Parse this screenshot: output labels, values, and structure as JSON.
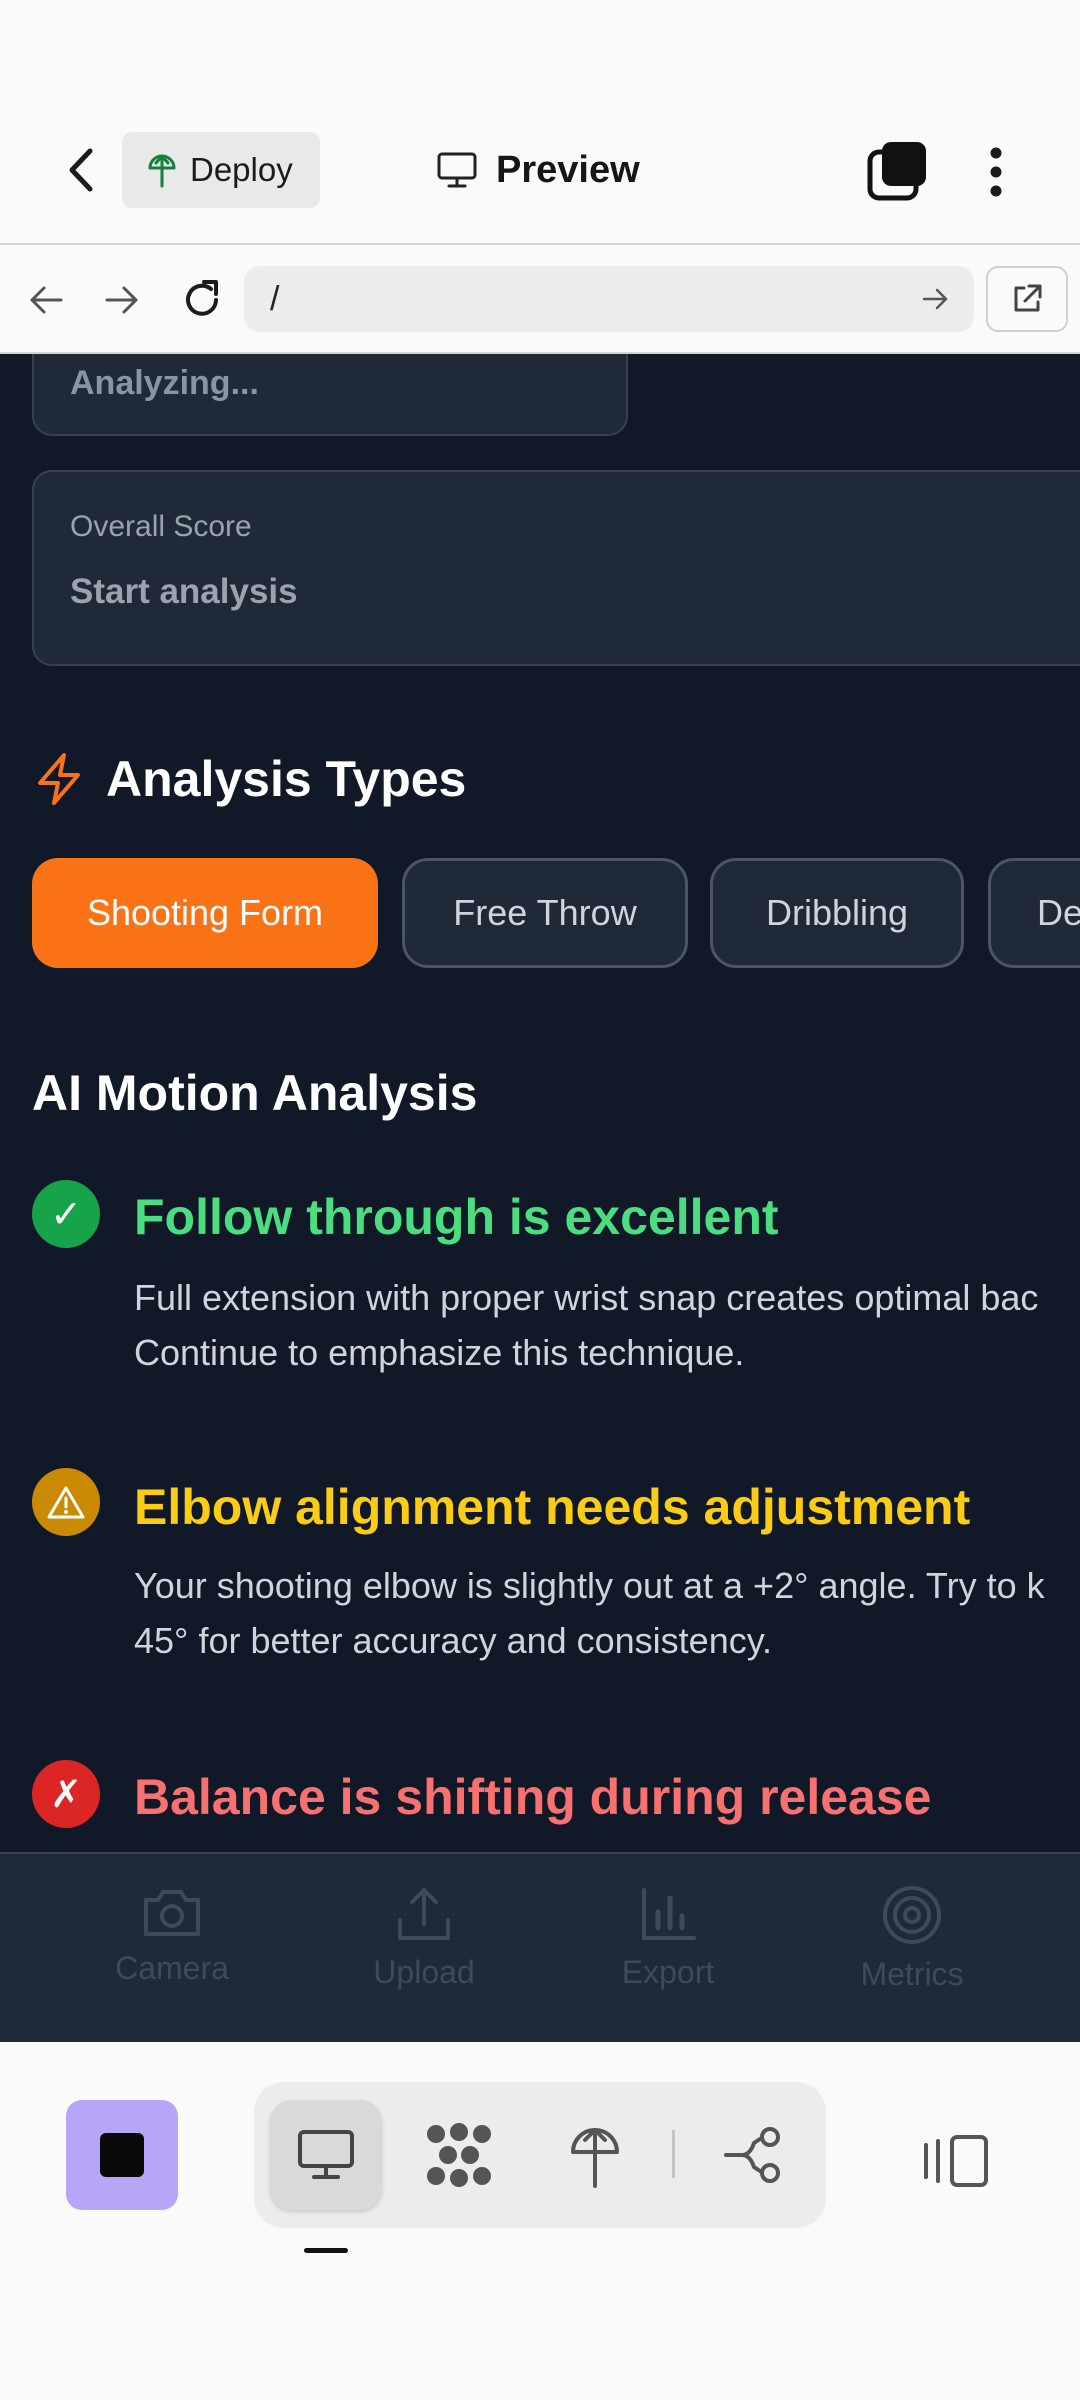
{
  "topbar": {
    "deploy_label": "Deploy",
    "preview_label": "Preview"
  },
  "browser": {
    "url": "/"
  },
  "app": {
    "analyzing_text": "Analyzing...",
    "score_card": {
      "label": "Overall Score",
      "value": "Start analysis"
    },
    "analysis_types": {
      "title": "Analysis Types",
      "chips": [
        "Shooting Form",
        "Free Throw",
        "Dribbling",
        "De"
      ],
      "selected": "Shooting Form"
    },
    "ai_section_title": "AI Motion Analysis",
    "insights": [
      {
        "status": "success",
        "icon": "✓",
        "title": "Follow through is excellent",
        "body_line1": "Full extension with proper wrist snap creates optimal bac",
        "body_line2": "Continue to emphasize this technique."
      },
      {
        "status": "warning",
        "icon": "⚠",
        "title": "Elbow alignment needs adjustment",
        "body_line1": "Your shooting elbow is slightly out at a +2° angle. Try to k",
        "body_line2": "45° for better accuracy and consistency."
      },
      {
        "status": "error",
        "icon": "✗",
        "title": "Balance is shifting during release"
      }
    ],
    "bottom_nav": [
      "Camera",
      "Upload",
      "Export",
      "Metrics"
    ]
  },
  "colors": {
    "accent": "#f97316",
    "success": "#4ade80",
    "warning": "#facc15",
    "error": "#f87171",
    "background": "#111827"
  }
}
